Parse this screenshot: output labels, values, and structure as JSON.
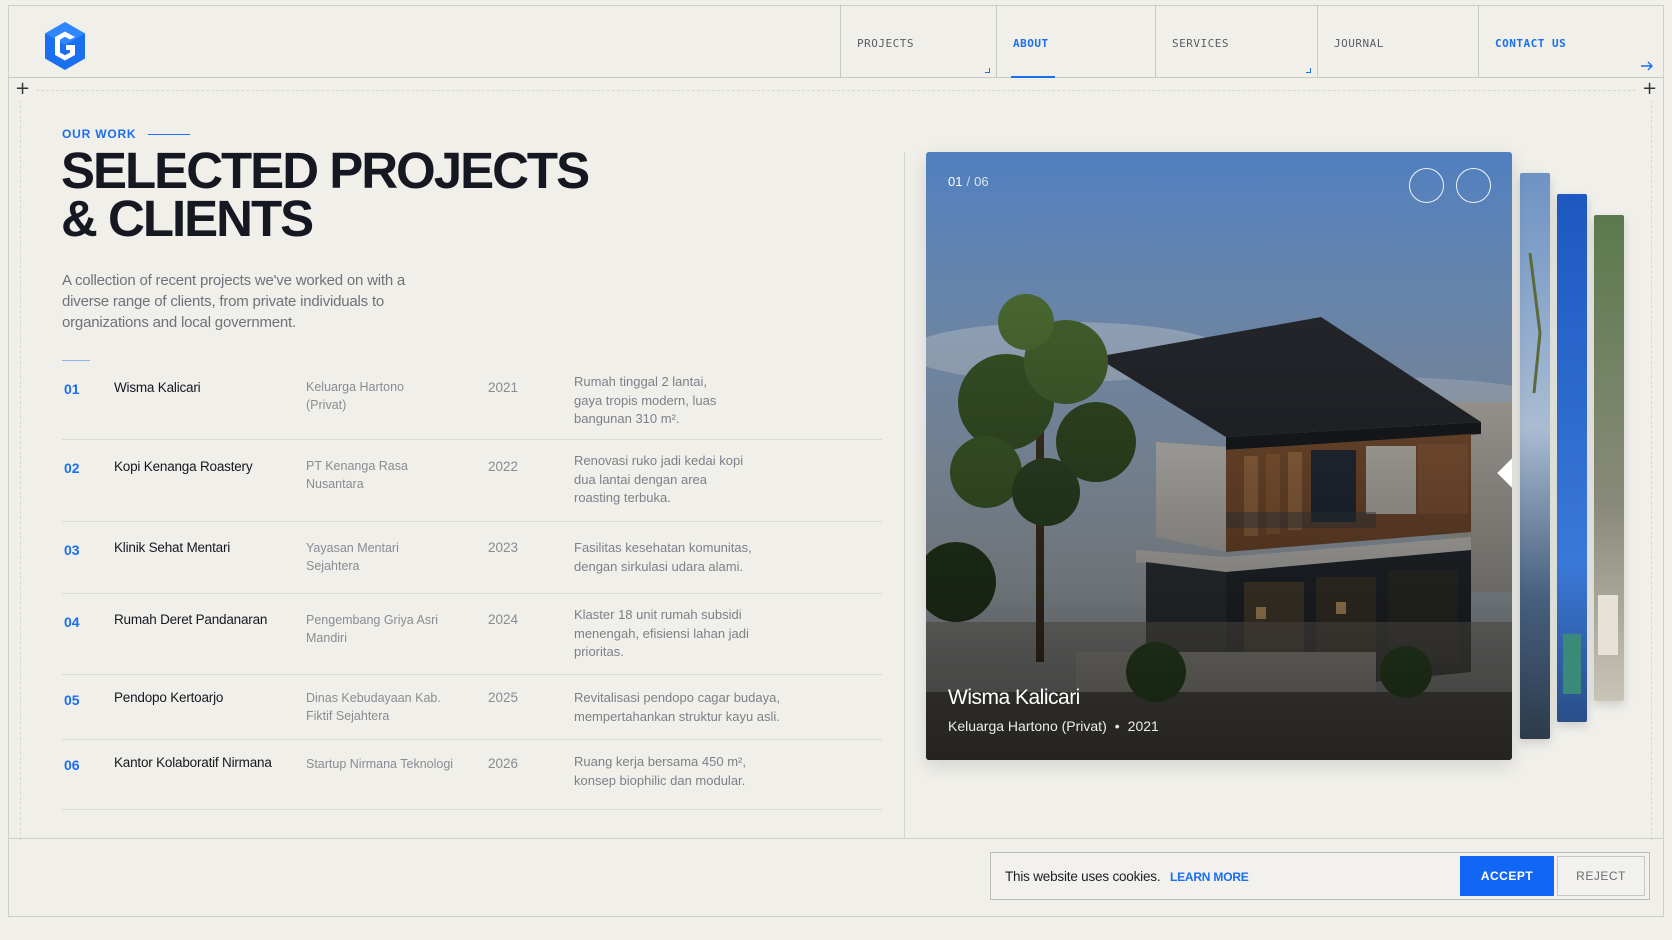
{
  "colors": {
    "accent": "#1a6ff0",
    "background": "#f0efea",
    "accept_button": "#1166f5"
  },
  "nav": {
    "items": [
      {
        "label": "PROJECTS",
        "state": "default"
      },
      {
        "label": "ABOUT",
        "state": "active"
      },
      {
        "label": "SERVICES",
        "state": "default"
      },
      {
        "label": "JOURNAL",
        "state": "default"
      },
      {
        "label": "CONTACT US",
        "state": "cta"
      }
    ]
  },
  "hero": {
    "eyebrow": "OUR WORK",
    "title_line1": "SELECTED PROJECTS",
    "title_line2": "& CLIENTS",
    "intro": "A collection of recent projects we've worked on with a diverse range of clients, from private individuals to organizations and local government."
  },
  "projects": [
    {
      "num": "01",
      "name": "Wisma Kalicari",
      "client": "Keluarga Hartono (Privat)",
      "year": "2021",
      "desc": "Rumah tinggal 2 lantai, gaya tropis modern, luas bangunan 310 m²."
    },
    {
      "num": "02",
      "name": "Kopi Kenanga Roastery",
      "client": "PT Kenanga Rasa Nusantara",
      "year": "2022",
      "desc": "Renovasi ruko jadi kedai kopi dua lantai dengan area roasting terbuka."
    },
    {
      "num": "03",
      "name": "Klinik Sehat Mentari",
      "client": "Yayasan Mentari Sejahtera",
      "year": "2023",
      "desc": "Fasilitas kesehatan komunitas, dengan sirkulasi udara alami."
    },
    {
      "num": "04",
      "name": "Rumah Deret Pandanaran",
      "client": "Pengembang Griya Asri Mandiri",
      "year": "2024",
      "desc": "Klaster 18 unit rumah subsidi menengah, efisiensi lahan jadi prioritas."
    },
    {
      "num": "05",
      "name": "Pendopo Kertoarjo",
      "client": "Dinas Kebudayaan Kab. Fiktif Sejahtera",
      "year": "2025",
      "desc": "Revitalisasi pendopo cagar budaya, mempertahankan struktur kayu asli."
    },
    {
      "num": "06",
      "name": "Kantor Kolaboratif Nirmana",
      "client": "Startup Nirmana Teknologi",
      "year": "2026",
      "desc": "Ruang kerja bersama 450 m², konsep biophilic dan modular."
    }
  ],
  "slider": {
    "current": "01",
    "separator": "/",
    "total": "06",
    "caption_title": "Wisma Kalicari",
    "caption_client": "Keluarga Hartono (Privat)",
    "caption_dot": "•",
    "caption_year": "2021",
    "prev_icon": "chevron-left-icon",
    "next_icon": "chevron-right-icon"
  },
  "cookie": {
    "text": "This website uses cookies.",
    "link": "LEARN MORE",
    "accept": "ACCEPT",
    "reject": "REJECT"
  }
}
